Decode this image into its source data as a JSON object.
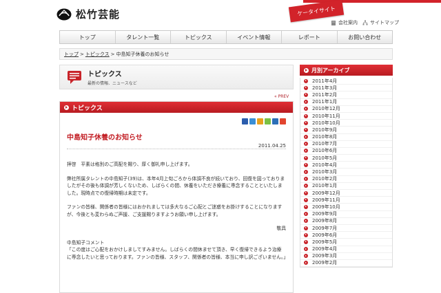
{
  "header": {
    "logo_text": "松竹芸能",
    "mobile_site_label": "ケータイサイト",
    "company_info_label": "会社案内",
    "sitemap_label": "サイトマップ"
  },
  "nav": {
    "items": [
      "トップ",
      "タレント一覧",
      "トピックス",
      "イベント情報",
      "レポート",
      "お問い合わせ"
    ]
  },
  "breadcrumb": {
    "home": "トップ",
    "sep": ">",
    "section": "トピックス",
    "current": "中島知子休養のお知らせ"
  },
  "topics_header": {
    "title": "トピックス",
    "subtitle": "最新の情報、ニュースなど"
  },
  "prev_label": "« PREV",
  "article": {
    "section_label": "トピックス",
    "title": "中島知子休養のお知らせ",
    "date": "2011.04.25",
    "paragraphs": [
      "拝啓　平素は格別のご高配を賜り、厚く御礼申し上げます。",
      "弊社所属タレントの中島知子(39)は、本年4月上旬ごろから体調不良が続いており、回復を図っておりましたがその後も体調が芳しくないため、しばらくの間、休養をいただき療養に専念することといたしました。現時点での復帰時期は未定です。",
      "ファンの皆様、関係者の皆様にはおかれましては多大なるご心配とご迷惑をお掛けすることになりますが、今後とも変わらぬご声援、ご支援賜りますようお願い申し上げます。",
      "敬具",
      "中島知子コメント",
      "「この度はご心配をおかけしましてすみません。しばらくの間休ませて頂き、早く復帰できるよう治療に専念したいと思っております。ファンの皆様、スタッフ、関係者の皆様、本当に申し訳ございません。」"
    ]
  },
  "archive": {
    "title": "月別アーカイブ",
    "months": [
      "2011年4月",
      "2011年3月",
      "2011年2月",
      "2011年1月",
      "2010年12月",
      "2010年11月",
      "2010年10月",
      "2010年9月",
      "2010年8月",
      "2010年7月",
      "2010年6月",
      "2010年5月",
      "2010年4月",
      "2010年3月",
      "2010年2月",
      "2010年1月",
      "2009年12月",
      "2009年11月",
      "2009年10月",
      "2009年9月",
      "2009年8月",
      "2009年7月",
      "2009年6月",
      "2009年5月",
      "2009年4月",
      "2009年3月",
      "2009年2月"
    ]
  },
  "colors": {
    "accent": "#c8242a",
    "bar_top": "#e02f35",
    "bar_bottom": "#b81b21"
  }
}
